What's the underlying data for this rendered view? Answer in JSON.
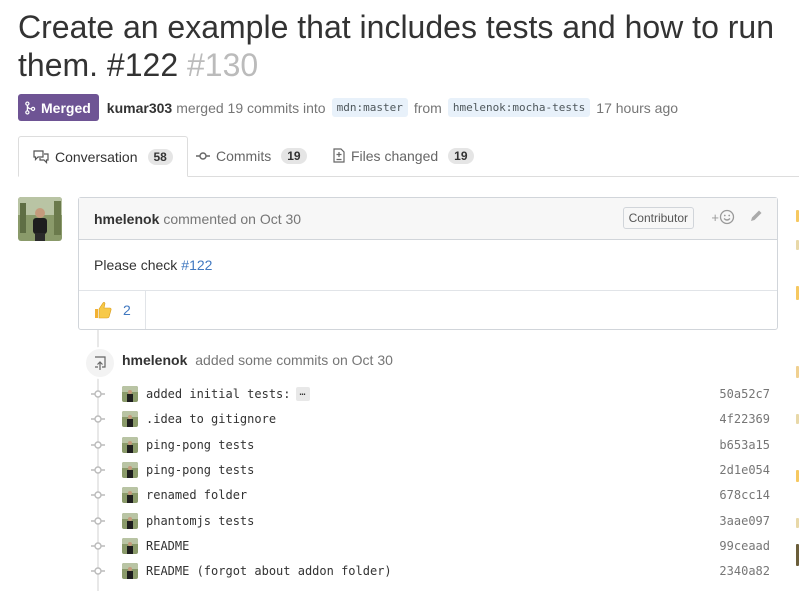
{
  "pr": {
    "title": "Create an example that includes tests and how to run",
    "title_line2": "them. #122",
    "number": "#130",
    "state_label": "Merged",
    "author": "kumar303",
    "merge_text_pre": "merged 19 commits into",
    "base_branch": "mdn:master",
    "merge_text_from": "from",
    "head_branch": "hmelenok:mocha-tests",
    "time": "17 hours ago"
  },
  "tabs": [
    {
      "label": "Conversation",
      "count": "58",
      "icon": "comment-discussion-icon"
    },
    {
      "label": "Commits",
      "count": "19",
      "icon": "git-commit-icon"
    },
    {
      "label": "Files changed",
      "count": "19",
      "icon": "diff-icon"
    }
  ],
  "comment": {
    "author": "hmelenok",
    "action": "commented on Oct 30",
    "badge": "Contributor",
    "react_plus": "+",
    "body_text": "Please check",
    "body_link": "#122",
    "reaction_icon": "thumbs-up",
    "reaction_count": "2"
  },
  "event": {
    "author": "hmelenok",
    "text": "added some commits on Oct 30"
  },
  "commits": [
    {
      "message": "added initial tests:",
      "has_ellipsis": true,
      "ellipsis": "…",
      "sha": "50a52c7"
    },
    {
      "message": ".idea to gitignore",
      "sha": "4f22369"
    },
    {
      "message": "ping-pong tests",
      "sha": "b653a15"
    },
    {
      "message": "ping-pong tests",
      "sha": "2d1e054"
    },
    {
      "message": "renamed folder",
      "sha": "678cc14"
    },
    {
      "message": "phantomjs tests",
      "sha": "3aae097"
    },
    {
      "message": "README",
      "sha": "99ceaad"
    },
    {
      "message": "README (forgot about addon folder)",
      "sha": "2340a82"
    }
  ],
  "colors": {
    "merged": "#6e5494",
    "link": "#4078c0",
    "muted": "#767676"
  }
}
